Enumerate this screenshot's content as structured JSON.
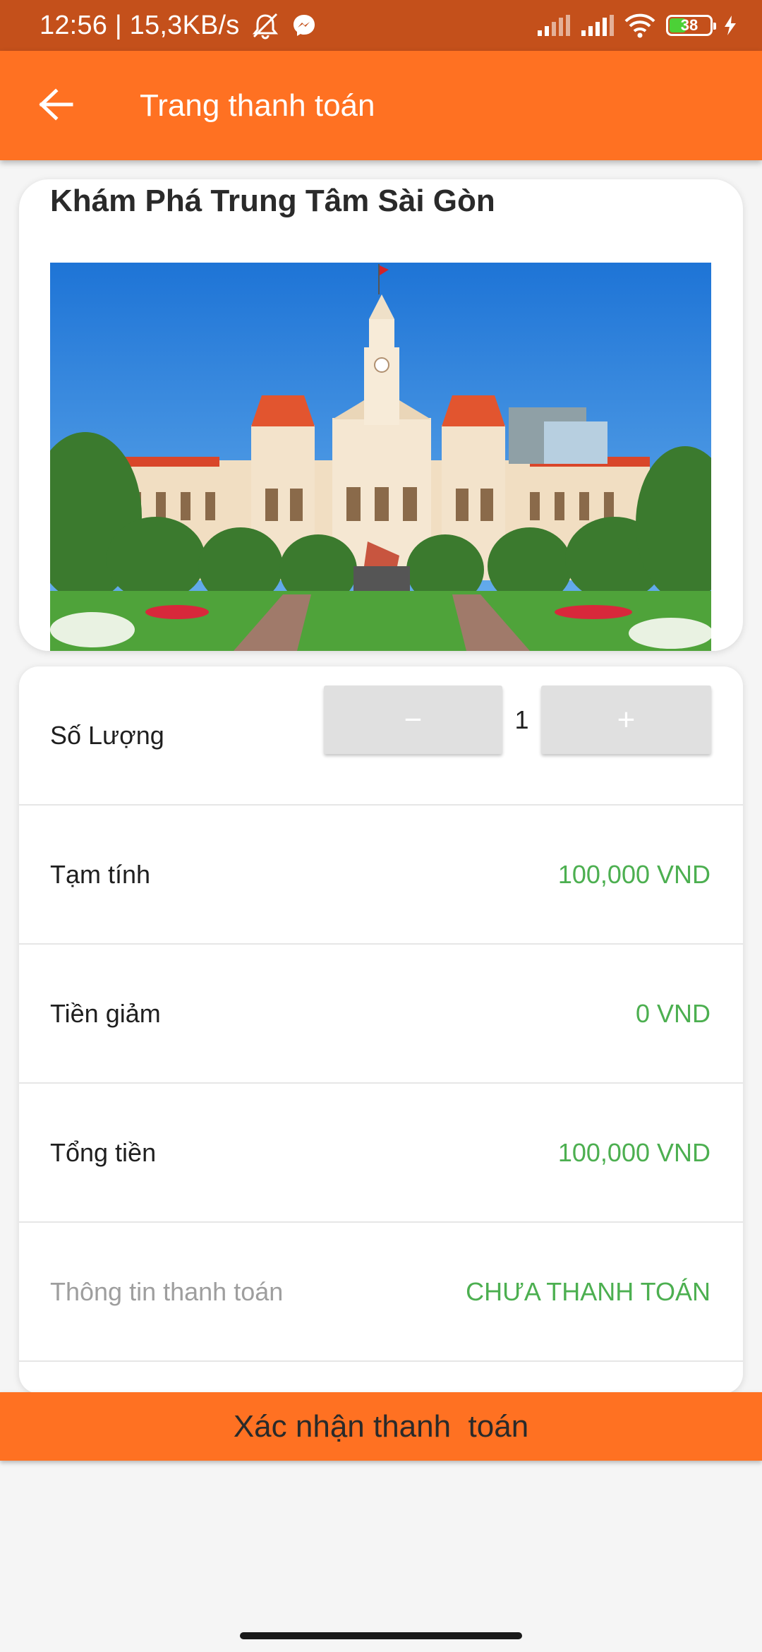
{
  "status_bar": {
    "time_speed": "12:56 | 15,3KB/s",
    "battery_level": "38",
    "icons": [
      "mute-icon",
      "messenger-icon",
      "signal-icon",
      "signal-icon",
      "wifi-icon",
      "battery-icon",
      "charging-icon"
    ]
  },
  "app_bar": {
    "title": "Trang thanh toán",
    "back_icon": "arrow-left-icon"
  },
  "tour": {
    "title": "Khám Phá Trung Tâm Sài Gòn"
  },
  "details": {
    "quantity_label": "Số Lượng",
    "quantity_value": "1",
    "minus_label": "−",
    "plus_label": "+",
    "subtotal_label": "Tạm tính",
    "subtotal_value": "100,000 VND",
    "discount_label": "Tiền giảm",
    "discount_value": "0 VND",
    "total_label": "Tổng tiền",
    "total_value": "100,000 VND",
    "payment_info_label": "Thông tin thanh toán",
    "payment_status": "CHƯA THANH TOÁN"
  },
  "confirm_label": "Xác nhận thanh  toán",
  "colors": {
    "status_bar": "#C4501B",
    "primary": "#FF7122",
    "value_green": "#4CAF50"
  }
}
